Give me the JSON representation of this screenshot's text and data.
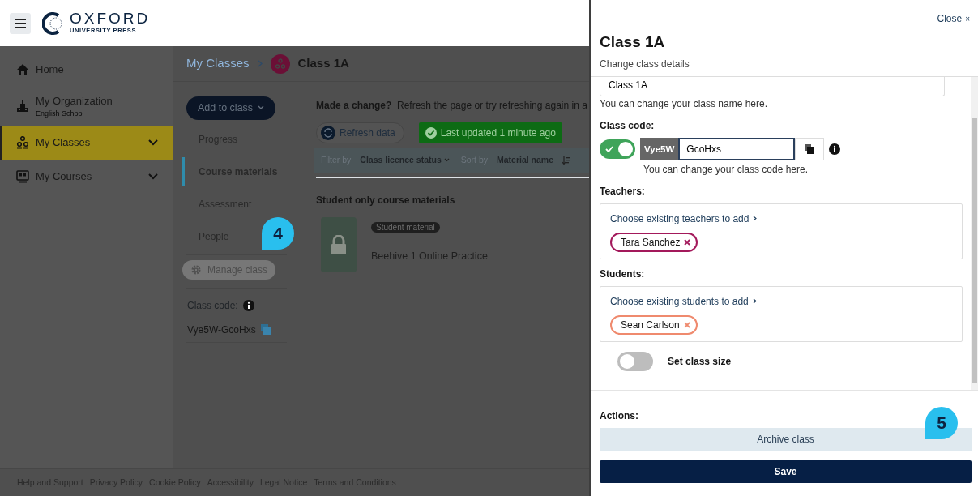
{
  "header": {
    "logo_name": "OXFORD",
    "logo_sub": "UNIVERSITY PRESS"
  },
  "sidebar": {
    "items": [
      {
        "kind": "home",
        "label": "Home",
        "selected": false
      },
      {
        "kind": "organization",
        "label": "My Organization",
        "sublabel": "English School",
        "selected": false
      },
      {
        "kind": "classes",
        "label": "My Classes",
        "selected": true,
        "expandable": true
      },
      {
        "kind": "courses",
        "label": "My Courses",
        "selected": false,
        "expandable": true
      }
    ]
  },
  "breadcrumb": {
    "parent": "My Classes",
    "current": "Class 1A"
  },
  "class_nav": {
    "add_button": "Add to class",
    "items": [
      {
        "label": "Progress",
        "selected": false
      },
      {
        "label": "Course materials",
        "selected": true
      },
      {
        "label": "Assessment",
        "selected": false
      },
      {
        "label": "People",
        "selected": false
      }
    ],
    "manage_button": "Manage class",
    "code_label": "Class code:",
    "code": "Vye5W-GcoHxs"
  },
  "main": {
    "notice_title": "Made a change?",
    "notice_text": "Refresh the page or try refreshing again in a",
    "refresh_button": "Refresh data",
    "status": "Last updated 1 minute ago",
    "filter_label": "Filter by",
    "filter_value": "Class licence status",
    "sort_label": "Sort by",
    "sort_value": "Material name",
    "section_title": "Student only course materials",
    "materials": [
      {
        "tag": "Student material",
        "title": "Beehive 1 Online Practice"
      }
    ]
  },
  "footer_links": [
    "Help and Support",
    "Privacy Policy",
    "Cookie Policy",
    "Accessibility",
    "Legal Notice",
    "Terms and Conditions"
  ],
  "panel": {
    "close": "Close",
    "close_icon": "×",
    "title": "Class 1A",
    "subtitle": "Change class details",
    "class_name_value": "Class 1A",
    "class_name_help": "You can change your class name here.",
    "code_label": "Class code:",
    "code_toggle_on": true,
    "code_prefix": "Vye5W",
    "code_value": "GcoHxs",
    "code_help": "You can change your class code here.",
    "teachers": {
      "label": "Teachers:",
      "link": "Choose existing teachers to add",
      "people": [
        {
          "name": "Tara Sanchez",
          "color": "#a3195b"
        }
      ]
    },
    "students": {
      "label": "Students:",
      "link": "Choose existing students to add",
      "people": [
        {
          "name": "Sean Carlson",
          "color": "#ef8a6e"
        }
      ]
    },
    "class_size_on": false,
    "class_size_label": "Set class size",
    "actions_label": "Actions:",
    "archive_button": "Archive class",
    "save_button": "Save"
  },
  "callouts": [
    {
      "label": "4"
    },
    {
      "label": "5"
    }
  ]
}
